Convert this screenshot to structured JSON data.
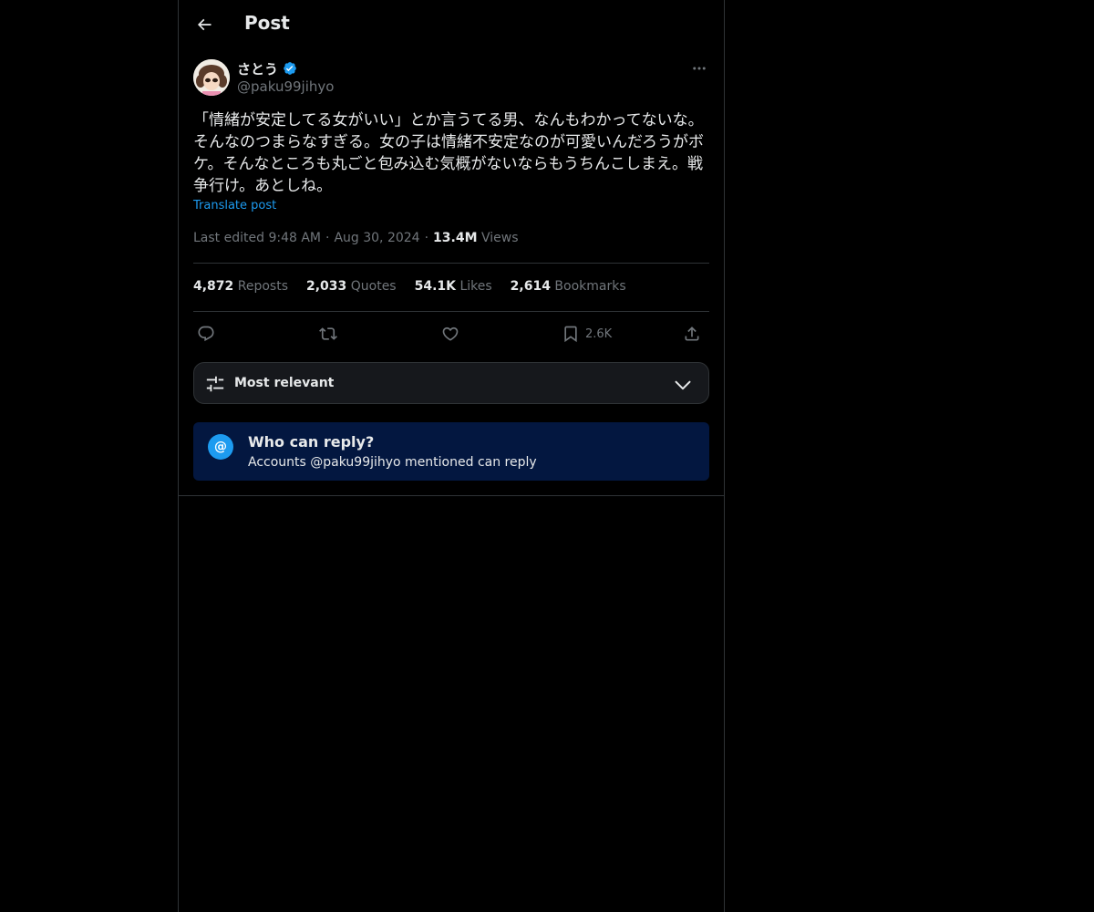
{
  "header": {
    "title": "Post"
  },
  "post": {
    "author": {
      "display_name": "さとう",
      "handle": "@paku99jihyo",
      "verified": true
    },
    "text": "「情緒が安定してる女がいい」とか言うてる男、なんもわかってないな。そんなのつまらなすぎる。女の子は情緒不安定なのが可愛いんだろうがボケ。そんなところも丸ごと包み込む気概がないならもうちんこしまえ。戦争行け。あとしね。",
    "translate_label": "Translate post",
    "meta": {
      "edited_label": "Last edited 9:48 AM",
      "sep1": "·",
      "date": "Aug 30, 2024",
      "sep2": "·",
      "views_count": "13.4M",
      "views_label": "Views"
    },
    "stats": [
      {
        "count": "4,872",
        "label": "Reposts"
      },
      {
        "count": "2,033",
        "label": "Quotes"
      },
      {
        "count": "54.1K",
        "label": "Likes"
      },
      {
        "count": "2,614",
        "label": "Bookmarks"
      }
    ],
    "actions": {
      "bookmark_count": "2.6K"
    }
  },
  "sort": {
    "label": "Most relevant"
  },
  "reply_restriction": {
    "badge": "@",
    "title": "Who can reply?",
    "subtitle": "Accounts @paku99jihyo mentioned can reply"
  },
  "colors": {
    "accent": "#1d9bf0",
    "background": "#000000",
    "card": "#031740"
  }
}
